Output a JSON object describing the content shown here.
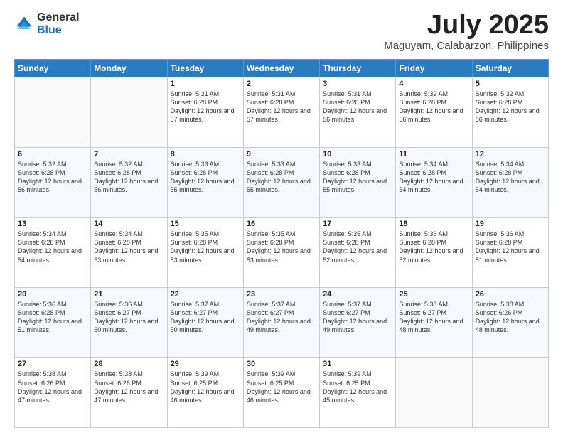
{
  "logo": {
    "general": "General",
    "blue": "Blue"
  },
  "header": {
    "month": "July 2025",
    "location": "Maguyam, Calabarzon, Philippines"
  },
  "weekdays": [
    "Sunday",
    "Monday",
    "Tuesday",
    "Wednesday",
    "Thursday",
    "Friday",
    "Saturday"
  ],
  "weeks": [
    [
      {
        "day": "",
        "info": ""
      },
      {
        "day": "",
        "info": ""
      },
      {
        "day": "1",
        "info": "Sunrise: 5:31 AM\nSunset: 6:28 PM\nDaylight: 12 hours and 57 minutes."
      },
      {
        "day": "2",
        "info": "Sunrise: 5:31 AM\nSunset: 6:28 PM\nDaylight: 12 hours and 57 minutes."
      },
      {
        "day": "3",
        "info": "Sunrise: 5:31 AM\nSunset: 6:28 PM\nDaylight: 12 hours and 56 minutes."
      },
      {
        "day": "4",
        "info": "Sunrise: 5:32 AM\nSunset: 6:28 PM\nDaylight: 12 hours and 56 minutes."
      },
      {
        "day": "5",
        "info": "Sunrise: 5:32 AM\nSunset: 6:28 PM\nDaylight: 12 hours and 56 minutes."
      }
    ],
    [
      {
        "day": "6",
        "info": "Sunrise: 5:32 AM\nSunset: 6:28 PM\nDaylight: 12 hours and 56 minutes."
      },
      {
        "day": "7",
        "info": "Sunrise: 5:32 AM\nSunset: 6:28 PM\nDaylight: 12 hours and 56 minutes."
      },
      {
        "day": "8",
        "info": "Sunrise: 5:33 AM\nSunset: 6:28 PM\nDaylight: 12 hours and 55 minutes."
      },
      {
        "day": "9",
        "info": "Sunrise: 5:33 AM\nSunset: 6:28 PM\nDaylight: 12 hours and 55 minutes."
      },
      {
        "day": "10",
        "info": "Sunrise: 5:33 AM\nSunset: 6:28 PM\nDaylight: 12 hours and 55 minutes."
      },
      {
        "day": "11",
        "info": "Sunrise: 5:34 AM\nSunset: 6:28 PM\nDaylight: 12 hours and 54 minutes."
      },
      {
        "day": "12",
        "info": "Sunrise: 5:34 AM\nSunset: 6:28 PM\nDaylight: 12 hours and 54 minutes."
      }
    ],
    [
      {
        "day": "13",
        "info": "Sunrise: 5:34 AM\nSunset: 6:28 PM\nDaylight: 12 hours and 54 minutes."
      },
      {
        "day": "14",
        "info": "Sunrise: 5:34 AM\nSunset: 6:28 PM\nDaylight: 12 hours and 53 minutes."
      },
      {
        "day": "15",
        "info": "Sunrise: 5:35 AM\nSunset: 6:28 PM\nDaylight: 12 hours and 53 minutes."
      },
      {
        "day": "16",
        "info": "Sunrise: 5:35 AM\nSunset: 6:28 PM\nDaylight: 12 hours and 53 minutes."
      },
      {
        "day": "17",
        "info": "Sunrise: 5:35 AM\nSunset: 6:28 PM\nDaylight: 12 hours and 52 minutes."
      },
      {
        "day": "18",
        "info": "Sunrise: 5:36 AM\nSunset: 6:28 PM\nDaylight: 12 hours and 52 minutes."
      },
      {
        "day": "19",
        "info": "Sunrise: 5:36 AM\nSunset: 6:28 PM\nDaylight: 12 hours and 51 minutes."
      }
    ],
    [
      {
        "day": "20",
        "info": "Sunrise: 5:36 AM\nSunset: 6:28 PM\nDaylight: 12 hours and 51 minutes."
      },
      {
        "day": "21",
        "info": "Sunrise: 5:36 AM\nSunset: 6:27 PM\nDaylight: 12 hours and 50 minutes."
      },
      {
        "day": "22",
        "info": "Sunrise: 5:37 AM\nSunset: 6:27 PM\nDaylight: 12 hours and 50 minutes."
      },
      {
        "day": "23",
        "info": "Sunrise: 5:37 AM\nSunset: 6:27 PM\nDaylight: 12 hours and 49 minutes."
      },
      {
        "day": "24",
        "info": "Sunrise: 5:37 AM\nSunset: 6:27 PM\nDaylight: 12 hours and 49 minutes."
      },
      {
        "day": "25",
        "info": "Sunrise: 5:38 AM\nSunset: 6:27 PM\nDaylight: 12 hours and 48 minutes."
      },
      {
        "day": "26",
        "info": "Sunrise: 5:38 AM\nSunset: 6:26 PM\nDaylight: 12 hours and 48 minutes."
      }
    ],
    [
      {
        "day": "27",
        "info": "Sunrise: 5:38 AM\nSunset: 6:26 PM\nDaylight: 12 hours and 47 minutes."
      },
      {
        "day": "28",
        "info": "Sunrise: 5:38 AM\nSunset: 6:26 PM\nDaylight: 12 hours and 47 minutes."
      },
      {
        "day": "29",
        "info": "Sunrise: 5:39 AM\nSunset: 6:25 PM\nDaylight: 12 hours and 46 minutes."
      },
      {
        "day": "30",
        "info": "Sunrise: 5:39 AM\nSunset: 6:25 PM\nDaylight: 12 hours and 46 minutes."
      },
      {
        "day": "31",
        "info": "Sunrise: 5:39 AM\nSunset: 6:25 PM\nDaylight: 12 hours and 45 minutes."
      },
      {
        "day": "",
        "info": ""
      },
      {
        "day": "",
        "info": ""
      }
    ]
  ]
}
